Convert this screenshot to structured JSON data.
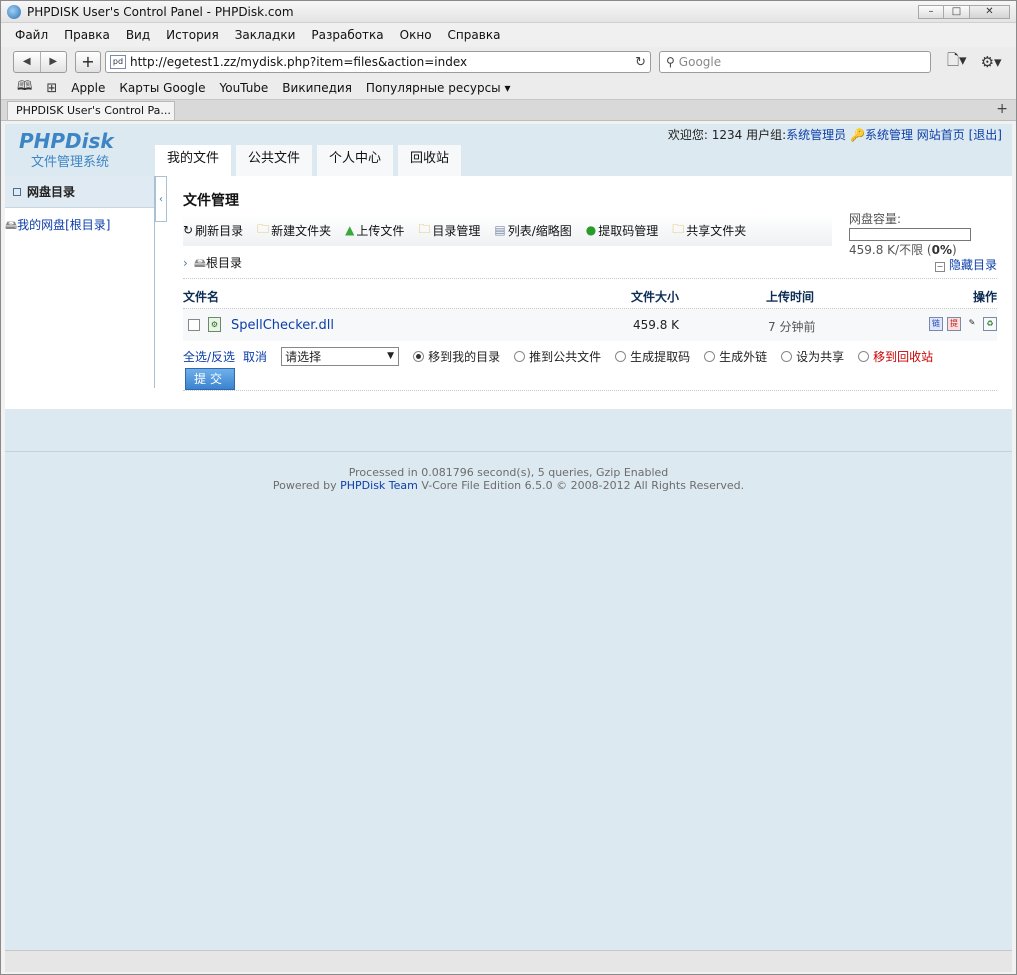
{
  "window": {
    "title": "PHPDISK User's Control Panel - PHPDisk.com"
  },
  "menu": [
    "Файл",
    "Правка",
    "Вид",
    "История",
    "Закладки",
    "Разработка",
    "Окно",
    "Справка"
  ],
  "address": {
    "url": "http://egetest1.zz/mydisk.php?item=files&action=index",
    "favicon": "pd"
  },
  "search": {
    "placeholder": "Google"
  },
  "bookmarks": [
    "Apple",
    "Карты Google",
    "YouTube",
    "Википедия",
    "Популярные ресурсы ▾"
  ],
  "tab": {
    "label": "PHPDISK User's Control Pa..."
  },
  "site": {
    "brand": "PHPDisk",
    "brand_sub": "文件管理系统",
    "welcome": "欢迎您: 1234",
    "group_label": "用户组:",
    "group": "系统管理员",
    "admin": "系统管理",
    "home": "网站首页",
    "logout": "[退出]",
    "nav": [
      "我的文件",
      "公共文件",
      "个人中心",
      "回收站"
    ]
  },
  "sidebar": {
    "header": "网盘目录",
    "item": "我的网盘[根目录]"
  },
  "main": {
    "title": "文件管理",
    "actions": [
      "刷新目录",
      "新建文件夹",
      "上传文件",
      "目录管理",
      "列表/缩略图",
      "提取码管理",
      "共享文件夹"
    ],
    "capacity_label": "网盘容量:",
    "capacity_used": "459.8 K/不限",
    "capacity_pct": "0%",
    "breadcrumb": "根目录",
    "hide_dir": "隐藏目录",
    "columns": {
      "name": "文件名",
      "size": "文件大小",
      "time": "上传时间",
      "ops": "操作"
    },
    "files": [
      {
        "name": "SpellChecker.dll",
        "size": "459.8 K",
        "time": "7 分钟前"
      }
    ],
    "select_all": "全选/反选",
    "cancel": "取消",
    "select_placeholder": "请选择",
    "options": [
      "移到我的目录",
      "推到公共文件",
      "生成提取码",
      "生成外链",
      "设为共享",
      "移到回收站"
    ],
    "selected_option": 0,
    "submit": "提交"
  },
  "footer": {
    "line1": "Processed in 0.081796 second(s), 5 queries, Gzip Enabled",
    "line2_pre": "Powered by",
    "team": "PHPDisk Team",
    "line2_post": "V-Core File Edition 6.5.0 © 2008-2012 All Rights Reserved."
  }
}
